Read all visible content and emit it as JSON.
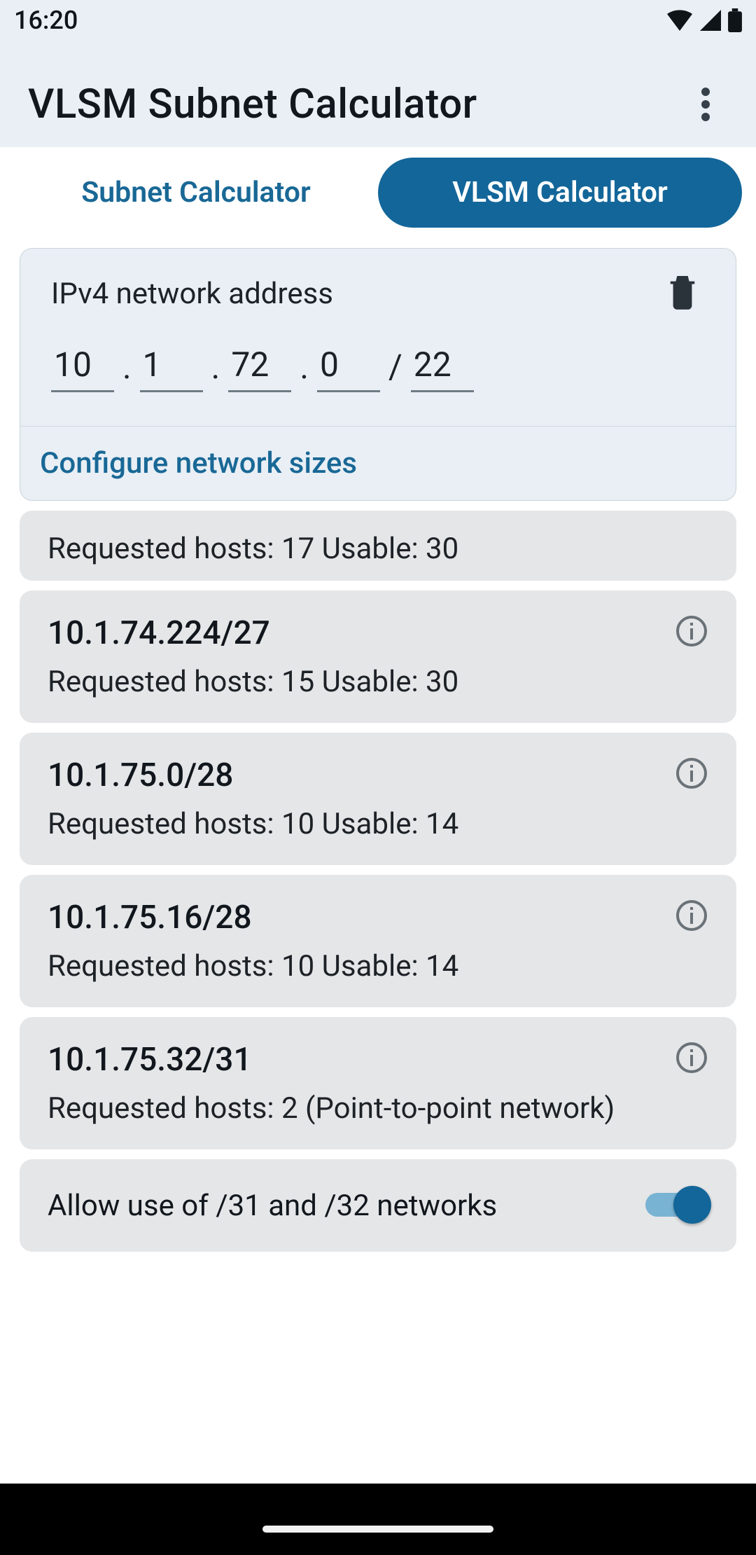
{
  "status": {
    "time": "16:20"
  },
  "app": {
    "title": "VLSM Subnet Calculator"
  },
  "tabs": {
    "subnet": "Subnet Calculator",
    "vlsm": "VLSM Calculator"
  },
  "ipcard": {
    "label": "IPv4 network address",
    "octets": [
      "10",
      "1",
      "72",
      "0"
    ],
    "cidr": "22",
    "configure": "Configure network sizes"
  },
  "partial_result": {
    "line2": "Requested hosts: 17 Usable: 30"
  },
  "results": [
    {
      "addr": "10.1.74.224/27",
      "line2": "Requested hosts: 15 Usable: 30"
    },
    {
      "addr": "10.1.75.0/28",
      "line2": "Requested hosts: 10 Usable: 14"
    },
    {
      "addr": "10.1.75.16/28",
      "line2": "Requested hosts: 10 Usable: 14"
    },
    {
      "addr": "10.1.75.32/31",
      "line2": "Requested hosts: 2 (Point-to-point network)"
    }
  ],
  "toggle": {
    "label": "Allow use of /31 and /32 networks",
    "on": true
  },
  "colors": {
    "accent": "#136699",
    "accent_light": "#79b3d4",
    "card_bg": "#e5e6e8",
    "panel_bg": "#e9eff5"
  }
}
